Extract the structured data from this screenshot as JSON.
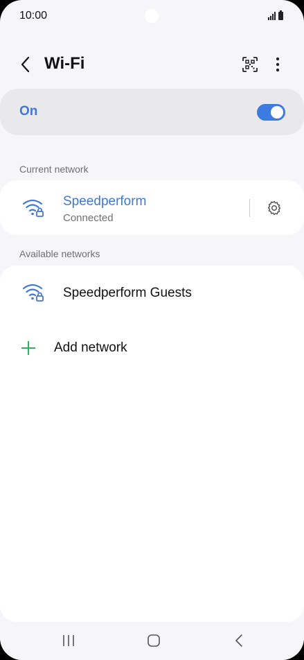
{
  "status_bar": {
    "time": "10:00"
  },
  "header": {
    "title": "Wi-Fi"
  },
  "wifi_toggle": {
    "label": "On",
    "state": "on"
  },
  "current_network": {
    "section_label": "Current network",
    "name": "Speedperform",
    "status": "Connected"
  },
  "available_networks": {
    "section_label": "Available networks",
    "items": [
      {
        "name": "Speedperform Guests"
      }
    ],
    "add_label": "Add network"
  },
  "colors": {
    "accent": "#3e78d8",
    "toggle_on": "#3e7be0",
    "add_green": "#2eb35a",
    "background": "#f6f6f8"
  },
  "icons": {
    "back": "chevron-left-icon",
    "qr": "qr-code-icon",
    "more": "more-vertical-icon",
    "wifi": "wifi-lock-icon",
    "settings": "gear-icon",
    "add": "plus-icon"
  }
}
